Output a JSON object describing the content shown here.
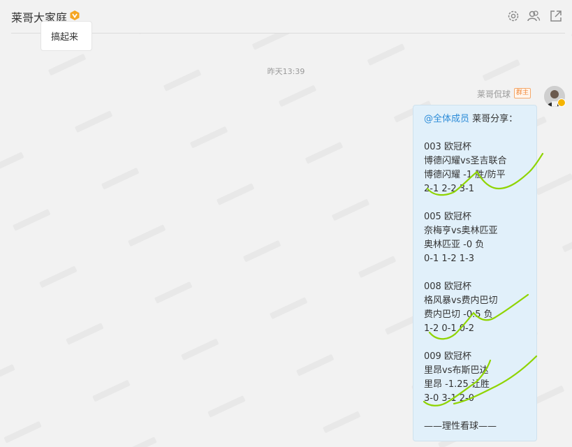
{
  "header": {
    "title": "莱哥大家庭",
    "icons": [
      "settings-icon",
      "members-icon",
      "popout-icon"
    ]
  },
  "previous_message": {
    "text": "搞起来"
  },
  "timestamp": "昨天13:39",
  "message": {
    "sender": "莱哥侃球",
    "role": "群主",
    "mention": "@全体成员",
    "intro": "莱哥分享：",
    "lines": [
      "003 欧冠杯",
      "博德闪耀vs圣吉联合",
      "博德闪耀 -1 胜/防平",
      "2-1 2-2 3-1",
      "",
      "005 欧冠杯",
      "奈梅亨vs奥林匹亚",
      "奥林匹亚 -0 负",
      "0-1 1-2 1-3",
      "",
      "008 欧冠杯",
      "格风暴vs费内巴切",
      "费内巴切 -0.5 负",
      "1-2 0-1 0-2",
      "",
      "009 欧冠杯",
      "里昂vs布斯巴达",
      "里昂 -1.25 让胜",
      "3-0 3-1 2-0",
      "",
      "——理性看球——"
    ]
  },
  "colors": {
    "mention": "#2d8cd8",
    "bubble": "#e1f0fa",
    "check_marks": "#8fd400",
    "badge": "#f08a3c"
  }
}
